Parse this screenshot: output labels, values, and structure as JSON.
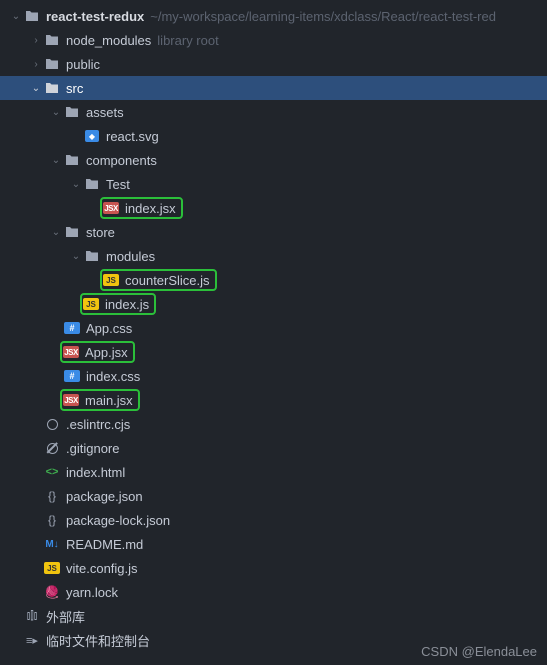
{
  "root": {
    "name": "react-test-redux",
    "path": "~/my-workspace/learning-items/xdclass/React/react-test-red"
  },
  "node_modules": {
    "name": "node_modules",
    "hint": "library root"
  },
  "public": "public",
  "src": "src",
  "assets": "assets",
  "react_svg": "react.svg",
  "components": "components",
  "test_dir": "Test",
  "test_index_jsx": "index.jsx",
  "store": "store",
  "modules": "modules",
  "counterSlice": "counterSlice.js",
  "store_index_js": "index.js",
  "app_css": "App.css",
  "app_jsx": "App.jsx",
  "index_css": "index.css",
  "main_jsx": "main.jsx",
  "eslintrc": ".eslintrc.cjs",
  "gitignore": ".gitignore",
  "index_html": "index.html",
  "package_json": "package.json",
  "package_lock": "package-lock.json",
  "readme": "README.md",
  "vite_config": "vite.config.js",
  "yarn_lock": "yarn.lock",
  "external_libs": "外部库",
  "scratches": "临时文件和控制台",
  "watermark": "CSDN @ElendaLee"
}
